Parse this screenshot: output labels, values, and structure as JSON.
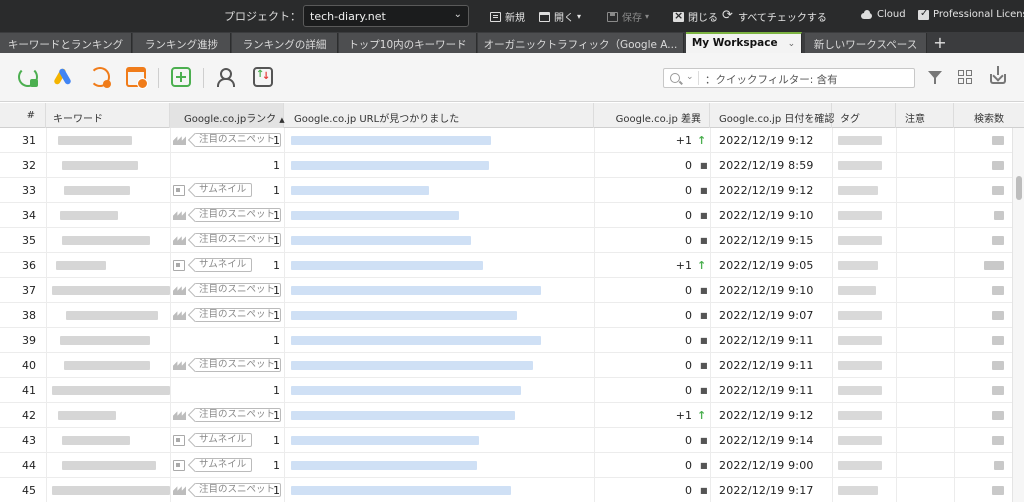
{
  "menubar": {
    "project_label": "プロジェクト：",
    "project_value": "tech-diary.net",
    "items": [
      {
        "label": "新規",
        "icon": "new-doc-icon",
        "disabled": false
      },
      {
        "label": "開く",
        "icon": "folder-open-icon",
        "disabled": false
      },
      {
        "label": "保存",
        "icon": "save-icon",
        "disabled": true
      },
      {
        "label": "閉じる",
        "icon": "close-box-icon",
        "disabled": false
      },
      {
        "label": "すべてチェックする",
        "icon": "sync-icon",
        "disabled": false
      },
      {
        "label": "Cloud",
        "icon": "cloud-icon",
        "disabled": false
      },
      {
        "label": "Professional License",
        "icon": "license-check-icon",
        "disabled": false
      }
    ]
  },
  "tabs": [
    {
      "label": "キーワードとランキング",
      "active": false
    },
    {
      "label": "ランキング進捗",
      "active": false
    },
    {
      "label": "ランキングの詳細",
      "active": false
    },
    {
      "label": "トップ10内のキーワード",
      "active": false
    },
    {
      "label": "オーガニックトラフィック（Google A...",
      "active": false
    },
    {
      "label": "My Workspace",
      "active": true
    },
    {
      "label": "新しいワークスペース",
      "active": false
    }
  ],
  "toolbar": {
    "filter_placeholder": "：クイックフィルター: 含有",
    "icons": [
      "refresh-rankings-icon",
      "google-ads-icon",
      "ads-analytics-icon",
      "schedule-icon",
      "add-keyword-icon",
      "users-icon",
      "sort-updown-icon"
    ]
  },
  "table": {
    "columns": [
      "#",
      "キーワード",
      "Google.co.jpランク",
      "Google.co.jp URLが見つかりました",
      "Google.co.jp 差異",
      "Google.co.jp 日付を確認",
      "タグ",
      "注意",
      "検索数"
    ],
    "sorted_column": "Google.co.jpランク",
    "feature_labels": {
      "snippet": "注目のスニペット",
      "thumbnail": "サムネイル"
    },
    "rows": [
      {
        "num": "31",
        "feature": "snippet",
        "rank": "1",
        "diff": "+1",
        "trend": "up",
        "date": "2022/12/19 9:12"
      },
      {
        "num": "32",
        "feature": "none",
        "rank": "1",
        "diff": "0",
        "trend": "same",
        "date": "2022/12/19 8:59"
      },
      {
        "num": "33",
        "feature": "thumbnail",
        "rank": "1",
        "diff": "0",
        "trend": "same",
        "date": "2022/12/19 9:12"
      },
      {
        "num": "34",
        "feature": "snippet",
        "rank": "1",
        "diff": "0",
        "trend": "same",
        "date": "2022/12/19 9:10"
      },
      {
        "num": "35",
        "feature": "snippet",
        "rank": "1",
        "diff": "0",
        "trend": "same",
        "date": "2022/12/19 9:15"
      },
      {
        "num": "36",
        "feature": "thumbnail",
        "rank": "1",
        "diff": "+1",
        "trend": "up",
        "date": "2022/12/19 9:05"
      },
      {
        "num": "37",
        "feature": "snippet",
        "rank": "1",
        "diff": "0",
        "trend": "same",
        "date": "2022/12/19 9:10"
      },
      {
        "num": "38",
        "feature": "snippet",
        "rank": "1",
        "diff": "0",
        "trend": "same",
        "date": "2022/12/19 9:07"
      },
      {
        "num": "39",
        "feature": "none",
        "rank": "1",
        "diff": "0",
        "trend": "same",
        "date": "2022/12/19 9:11"
      },
      {
        "num": "40",
        "feature": "snippet",
        "rank": "1",
        "diff": "0",
        "trend": "same",
        "date": "2022/12/19 9:11"
      },
      {
        "num": "41",
        "feature": "none",
        "rank": "1",
        "diff": "0",
        "trend": "same",
        "date": "2022/12/19 9:11"
      },
      {
        "num": "42",
        "feature": "snippet",
        "rank": "1",
        "diff": "+1",
        "trend": "up",
        "date": "2022/12/19 9:12"
      },
      {
        "num": "43",
        "feature": "thumbnail",
        "rank": "1",
        "diff": "0",
        "trend": "same",
        "date": "2022/12/19 9:14"
      },
      {
        "num": "44",
        "feature": "thumbnail",
        "rank": "1",
        "diff": "0",
        "trend": "same",
        "date": "2022/12/19 9:00"
      },
      {
        "num": "45",
        "feature": "snippet",
        "rank": "1",
        "diff": "0",
        "trend": "same",
        "date": "2022/12/19 9:17"
      }
    ]
  },
  "colors": {
    "accent": "#7cb342",
    "trend_up": "#4caf50",
    "menubar_bg": "#2a2b2c"
  }
}
